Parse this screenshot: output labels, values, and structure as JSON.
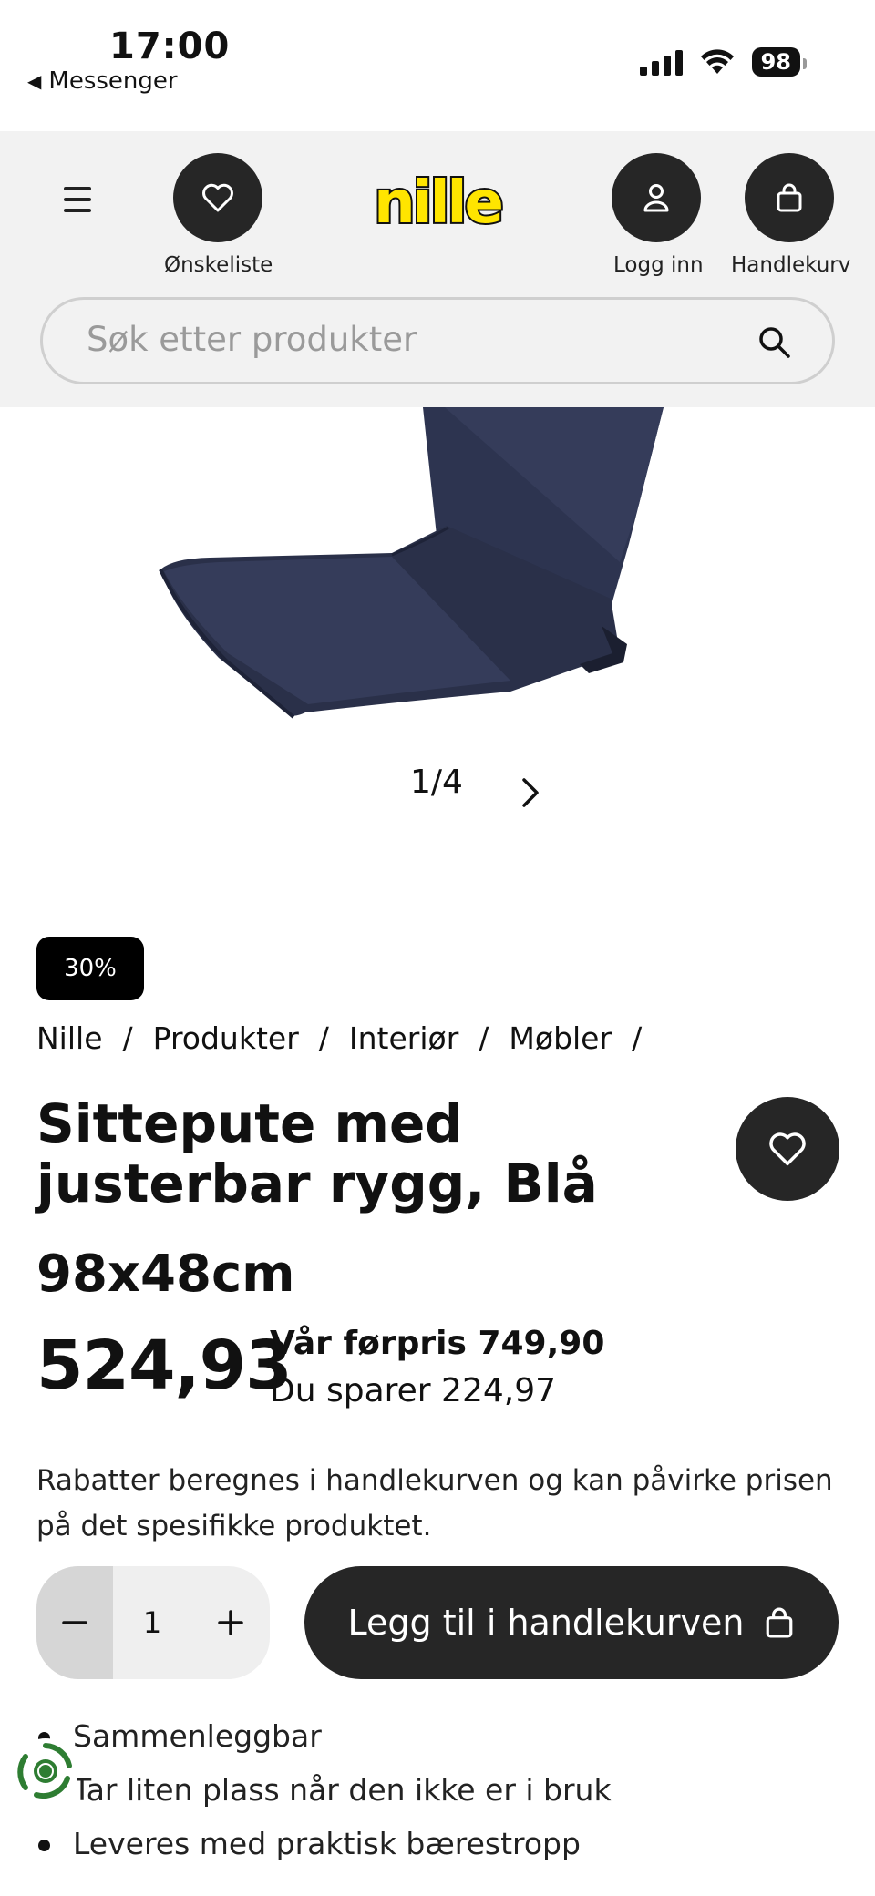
{
  "status_bar": {
    "time": "17:00",
    "back_app": "Messenger",
    "battery": "98"
  },
  "header": {
    "wishlist_label": "Ønskeliste",
    "login_label": "Logg inn",
    "cart_label": "Handlekurv",
    "logo_text": "nille",
    "search_placeholder": "Søk etter produkter"
  },
  "carousel": {
    "counter": "1/4"
  },
  "product": {
    "badge": "30%",
    "breadcrumb": [
      "Nille",
      "Produkter",
      "Interiør",
      "Møbler"
    ],
    "title": "Sittepute med justerbar rygg, Blå",
    "size": "98x48cm",
    "price": "524,93",
    "previous_price": "Vår førpris 749,90",
    "savings": "Du sparer 224,97",
    "note": "Rabatter beregnes i handlekurven og kan påvirke prisen på det spesifikke produktet.",
    "quantity": "1",
    "add_to_cart_label": "Legg til i handlekurven",
    "features": [
      "Sammenleggbar",
      "Tar liten plass når den ikke er i bruk",
      "Leveres med praktisk bærestropp"
    ]
  },
  "colors": {
    "header_bg": "#f2f2f2",
    "dark_button": "#262626",
    "logo_yellow": "#ffe500",
    "cushion": "#2d3450"
  },
  "icons": [
    "heart-icon",
    "user-icon",
    "bag-icon",
    "menu-icon",
    "search-icon",
    "chevron-right-icon",
    "minus-icon",
    "plus-icon"
  ]
}
